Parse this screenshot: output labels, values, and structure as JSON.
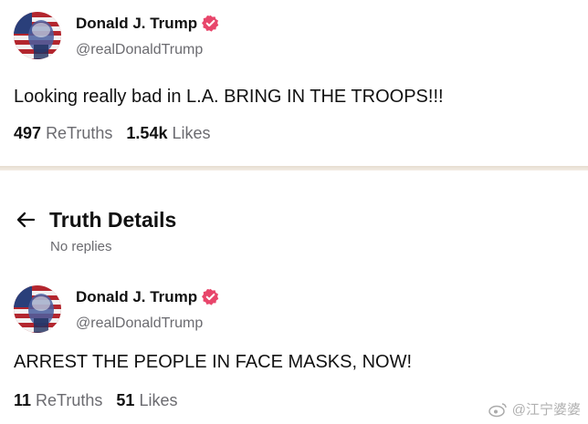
{
  "posts": [
    {
      "author": {
        "name": "Donald J. Trump",
        "handle": "@realDonaldTrump"
      },
      "text": "Looking really bad in L.A. BRING IN THE TROOPS!!!",
      "retruths": {
        "count": "497",
        "label": "ReTruths"
      },
      "likes": {
        "count": "1.54k",
        "label": "Likes"
      }
    },
    {
      "author": {
        "name": "Donald J. Trump",
        "handle": "@realDonaldTrump"
      },
      "text": "ARREST THE PEOPLE IN FACE MASKS, NOW!",
      "retruths": {
        "count": "11",
        "label": "ReTruths"
      },
      "likes": {
        "count": "51",
        "label": "Likes"
      }
    }
  ],
  "details": {
    "title": "Truth Details",
    "subtitle": "No replies"
  },
  "watermark": {
    "text": "@江宁婆婆",
    "icon": "weibo-icon"
  },
  "icons": {
    "avatar": "avatar-flag-portrait",
    "verified": "verified-badge-icon",
    "back": "back-arrow-icon"
  },
  "colors": {
    "verified_badge": "#e8466b",
    "secondary_text": "#6b6b70",
    "divider": "#ebe3d8"
  }
}
